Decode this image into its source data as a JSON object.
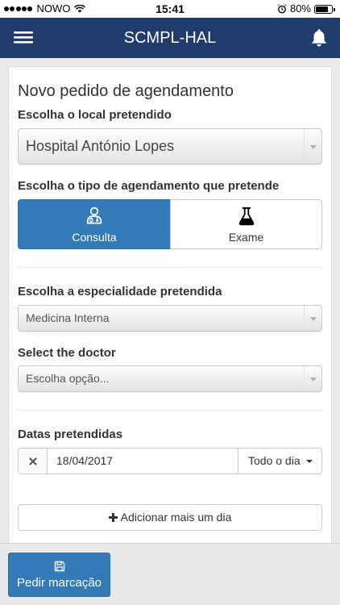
{
  "status_bar": {
    "carrier": "NOWO",
    "time": "15:41",
    "battery": "80%",
    "icons": [
      "signal-strength-icon",
      "wifi-icon",
      "alarm-icon",
      "battery-icon"
    ]
  },
  "header": {
    "title": "SCMPL-HAL",
    "menu_icon": "menu-icon",
    "notifications_icon": "bell-icon"
  },
  "form": {
    "title": "Novo pedido de agendamento",
    "location": {
      "label": "Escolha o local pretendido",
      "value": "Hospital António Lopes"
    },
    "appointment_type": {
      "label": "Escolha o tipo de agendamento que pretende",
      "options": [
        {
          "label": "Consulta",
          "icon": "doctor-icon",
          "selected": true
        },
        {
          "label": "Exame",
          "icon": "flask-icon",
          "selected": false
        }
      ]
    },
    "specialty": {
      "label": "Escolha a especialidade pretendida",
      "value": "Medicina Interna"
    },
    "doctor": {
      "label": "Select the doctor",
      "placeholder": "Escolha opção..."
    },
    "dates": {
      "label": "Datas pretendidas",
      "rows": [
        {
          "date": "18/04/2017",
          "period": "Todo o dia"
        }
      ]
    },
    "add_day": {
      "label": "Adicionar mais um dia",
      "icon": "plus-icon"
    }
  },
  "footer": {
    "submit": {
      "label": "Pedir marcação",
      "icon": "save-icon"
    }
  },
  "colors": {
    "header": "#1f3c6c",
    "primary": "#337ab7",
    "background": "#ebebeb",
    "text": "#333333"
  }
}
